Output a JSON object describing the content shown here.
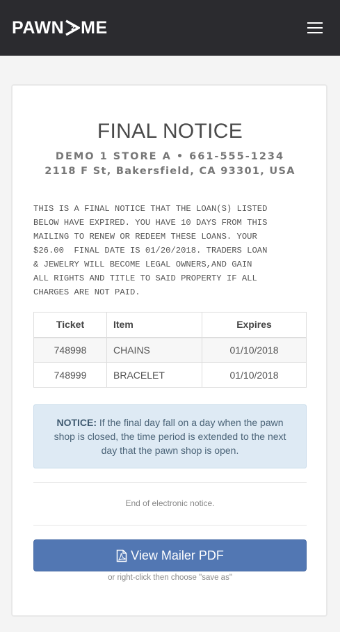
{
  "header": {
    "logo_left": "PAWN",
    "logo_right": "ME",
    "background": "#2b2b2f"
  },
  "notice": {
    "title": "FINAL NOTICE",
    "store": "DEMO 1 STORE A • 661-555-1234",
    "address": "2118 F St, Bakersfield, CA 93301, USA",
    "body": "THIS IS A FINAL NOTICE THAT THE LOAN(S) LISTED\nBELOW HAVE EXPIRED. YOU HAVE 10 DAYS FROM THIS\nMAILING TO RENEW OR REDEEM THESE LOANS. YOUR\n$26.00  FINAL DATE IS 01/20/2018. TRADERS LOAN\n& JEWELRY WILL BECOME LEGAL OWNERS,AND GAIN\nALL RIGHTS AND TITLE TO SAID PROPERTY IF ALL\nCHARGES ARE NOT PAID."
  },
  "table": {
    "headers": [
      "Ticket",
      "Item",
      "Expires"
    ],
    "rows": [
      [
        "748998",
        "CHAINS",
        "01/10/2018"
      ],
      [
        "748999",
        "BRACELET",
        "01/10/2018"
      ]
    ]
  },
  "alert": {
    "label": "NOTICE:",
    "text": " If the final day fall on a day when the pawn shop is closed, the time period is extended to the next day that the pawn shop is open."
  },
  "footer": {
    "end_note": "End of electronic notice.",
    "pdf_button": "View Mailer PDF",
    "hint": "or right-click then choose \"save as\""
  },
  "colors": {
    "accent_button": "#5277b3",
    "alert_bg": "#deeaf4"
  }
}
